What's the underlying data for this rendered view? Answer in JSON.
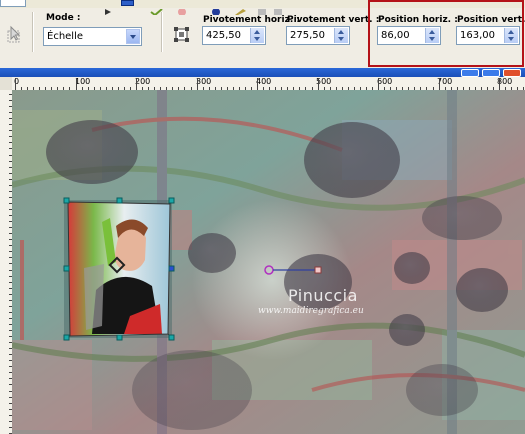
{
  "toolbar": {
    "mode": {
      "label": "Mode :",
      "value": "Échelle"
    },
    "pivot_x": {
      "label": "Pivotement horiz. :",
      "value": "425,50"
    },
    "pivot_y": {
      "label": "Pivotement vert. :",
      "value": "275,50"
    },
    "pos_x": {
      "label": "Position horiz. :",
      "value": "86,00"
    },
    "pos_y": {
      "label": "Position vert. :",
      "value": "163,00"
    }
  },
  "ruler": {
    "labels": [
      "0",
      "100",
      "200",
      "300",
      "400",
      "500",
      "600",
      "700",
      "800"
    ]
  },
  "watermark": {
    "name": "Pinuccia",
    "url": "www.maidiregrafica.eu"
  },
  "colors": {
    "highlight": "#b41218",
    "handle": "#15a0a0",
    "pivot": "#b030c0"
  }
}
